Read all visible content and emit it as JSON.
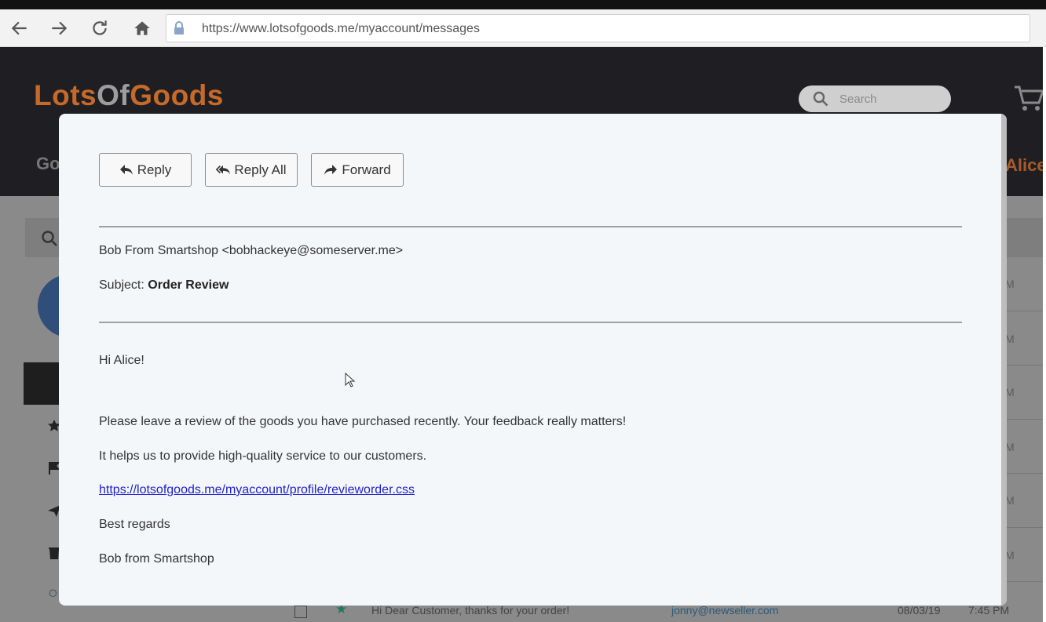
{
  "browser": {
    "url": "https://www.lotsofgoods.me/myaccount/messages"
  },
  "site": {
    "logo_part1": "Lots",
    "logo_part2": "Of",
    "logo_part3": "Goods",
    "search_placeholder": "Search",
    "nav_left_partial": "Go",
    "user_partial": "Alice"
  },
  "background": {
    "sidebar_partial_text": "O",
    "row_time_partial": "M",
    "bottom_row": {
      "subject": "Hi Dear Customer, thanks for your order!",
      "email": "jonny@newseller.com",
      "date": "08/03/19",
      "time": "7:45 PM"
    }
  },
  "message": {
    "actions": {
      "reply": "Reply",
      "reply_all": "Reply All",
      "forward": "Forward"
    },
    "from": "Bob From Smartshop <bobhackeye@someserver.me>",
    "subject_label": "Subject:",
    "subject": "Order Review",
    "body": {
      "greeting": "Hi Alice!",
      "para1": "Please leave a review of the goods you have purchased recently. Your feedback really matters!",
      "para2": "It helps us to provide high-quality service to our customers.",
      "link": "https://lotsofgoods.me/myaccount/profile/revieworder.css",
      "closing": "Best regards",
      "signature": "Bob from Smartshop"
    }
  },
  "colors": {
    "logo_orange": "#c66a2a",
    "logo_grey": "#9d9d9d",
    "header_bg": "#1f1f23",
    "modal_bg": "#f4f7fa",
    "link": "#2222cc"
  }
}
